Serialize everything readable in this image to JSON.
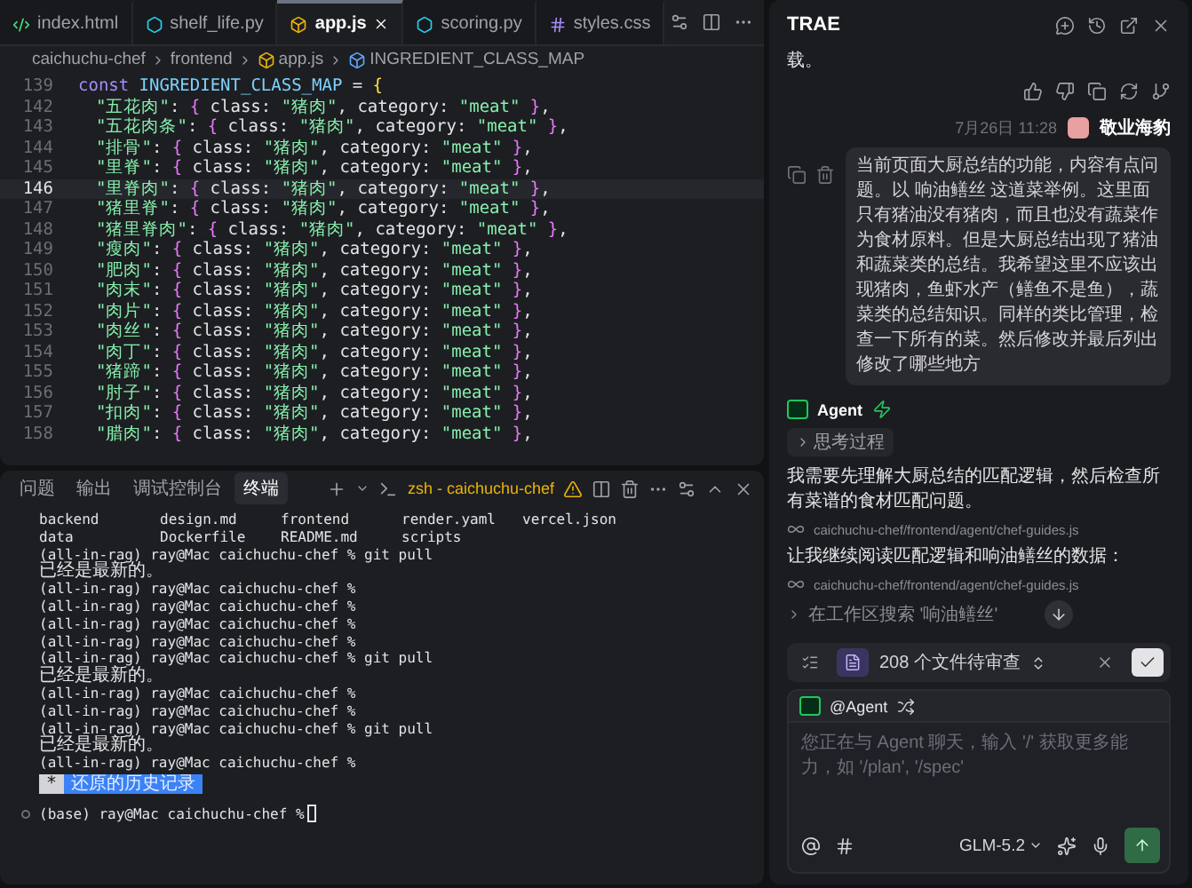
{
  "editor": {
    "tabs": [
      {
        "label": "index.html",
        "kind": "html",
        "selected": false
      },
      {
        "label": "shelf_life.py",
        "kind": "py",
        "selected": false
      },
      {
        "label": "app.js",
        "kind": "js",
        "selected": true
      },
      {
        "label": "scoring.py",
        "kind": "py",
        "selected": false
      },
      {
        "label": "styles.css",
        "kind": "css",
        "selected": false
      }
    ],
    "breadcrumb": [
      {
        "label": "caichuchu-chef",
        "kind": "folder"
      },
      {
        "label": "frontend",
        "kind": "folder"
      },
      {
        "label": "app.js",
        "kind": "js"
      },
      {
        "label": "INGREDIENT_CLASS_MAP",
        "kind": "symbol"
      }
    ],
    "lines": [
      {
        "number": "139",
        "indent": false,
        "current": false,
        "tokens": [
          {
            "kind": "keyword",
            "text": "const"
          },
          {
            "kind": "constant",
            "text": "INGREDIENT_CLASS_MAP"
          },
          {
            "kind": "plain",
            "text": "="
          },
          {
            "kind": "outer",
            "text": "{"
          }
        ]
      },
      {
        "number": "142",
        "indent": true,
        "current": false,
        "tokens": [
          {
            "kind": "string",
            "text": "\"五花肉\""
          },
          {
            "kind": "plain",
            "text": ":"
          },
          {
            "kind": "brace",
            "text": "{"
          },
          {
            "kind": "plain",
            "text": "class:"
          },
          {
            "kind": "string",
            "text": "\"猪肉\""
          },
          {
            "kind": "plain",
            "text": ", category:"
          },
          {
            "kind": "string",
            "text": "\"meat\""
          },
          {
            "kind": "brace",
            "text": "}"
          },
          {
            "kind": "plain",
            "text": ","
          }
        ]
      },
      {
        "number": "143",
        "indent": true,
        "current": false,
        "tokens": [
          {
            "kind": "string",
            "text": "\"五花肉条\""
          },
          {
            "kind": "plain",
            "text": ":"
          },
          {
            "kind": "brace",
            "text": "{"
          },
          {
            "kind": "plain",
            "text": "class:"
          },
          {
            "kind": "string",
            "text": "\"猪肉\""
          },
          {
            "kind": "plain",
            "text": ", category:"
          },
          {
            "kind": "string",
            "text": "\"meat\""
          },
          {
            "kind": "brace",
            "text": "}"
          },
          {
            "kind": "plain",
            "text": ","
          }
        ]
      },
      {
        "number": "144",
        "indent": true,
        "current": false,
        "tokens": [
          {
            "kind": "string",
            "text": "\"排骨\""
          },
          {
            "kind": "plain",
            "text": ":"
          },
          {
            "kind": "brace",
            "text": "{"
          },
          {
            "kind": "plain",
            "text": "class:"
          },
          {
            "kind": "string",
            "text": "\"猪肉\""
          },
          {
            "kind": "plain",
            "text": ", category:"
          },
          {
            "kind": "string",
            "text": "\"meat\""
          },
          {
            "kind": "brace",
            "text": "}"
          },
          {
            "kind": "plain",
            "text": ","
          }
        ]
      },
      {
        "number": "145",
        "indent": true,
        "current": false,
        "tokens": [
          {
            "kind": "string",
            "text": "\"里脊\""
          },
          {
            "kind": "plain",
            "text": ":"
          },
          {
            "kind": "brace",
            "text": "{"
          },
          {
            "kind": "plain",
            "text": "class:"
          },
          {
            "kind": "string",
            "text": "\"猪肉\""
          },
          {
            "kind": "plain",
            "text": ", category:"
          },
          {
            "kind": "string",
            "text": "\"meat\""
          },
          {
            "kind": "brace",
            "text": "}"
          },
          {
            "kind": "plain",
            "text": ","
          }
        ]
      },
      {
        "number": "146",
        "indent": true,
        "current": true,
        "tokens": [
          {
            "kind": "string",
            "text": "\"里脊肉\""
          },
          {
            "kind": "plain",
            "text": ":"
          },
          {
            "kind": "brace",
            "text": "{"
          },
          {
            "kind": "plain",
            "text": "class:"
          },
          {
            "kind": "string",
            "text": "\"猪肉\""
          },
          {
            "kind": "plain",
            "text": ", category:"
          },
          {
            "kind": "string",
            "text": "\"meat\""
          },
          {
            "kind": "brace",
            "text": "}"
          },
          {
            "kind": "plain",
            "text": ","
          }
        ]
      },
      {
        "number": "147",
        "indent": true,
        "current": false,
        "tokens": [
          {
            "kind": "string",
            "text": "\"猪里脊\""
          },
          {
            "kind": "plain",
            "text": ":"
          },
          {
            "kind": "brace",
            "text": "{"
          },
          {
            "kind": "plain",
            "text": "class:"
          },
          {
            "kind": "string",
            "text": "\"猪肉\""
          },
          {
            "kind": "plain",
            "text": ", category:"
          },
          {
            "kind": "string",
            "text": "\"meat\""
          },
          {
            "kind": "brace",
            "text": "}"
          },
          {
            "kind": "plain",
            "text": ","
          }
        ]
      },
      {
        "number": "148",
        "indent": true,
        "current": false,
        "tokens": [
          {
            "kind": "string",
            "text": "\"猪里脊肉\""
          },
          {
            "kind": "plain",
            "text": ":"
          },
          {
            "kind": "brace",
            "text": "{"
          },
          {
            "kind": "plain",
            "text": "class:"
          },
          {
            "kind": "string",
            "text": "\"猪肉\""
          },
          {
            "kind": "plain",
            "text": ", category:"
          },
          {
            "kind": "string",
            "text": "\"meat\""
          },
          {
            "kind": "brace",
            "text": "}"
          },
          {
            "kind": "plain",
            "text": ","
          }
        ]
      },
      {
        "number": "149",
        "indent": true,
        "current": false,
        "tokens": [
          {
            "kind": "string",
            "text": "\"瘦肉\""
          },
          {
            "kind": "plain",
            "text": ":"
          },
          {
            "kind": "brace",
            "text": "{"
          },
          {
            "kind": "plain",
            "text": "class:"
          },
          {
            "kind": "string",
            "text": "\"猪肉\""
          },
          {
            "kind": "plain",
            "text": ", category:"
          },
          {
            "kind": "string",
            "text": "\"meat\""
          },
          {
            "kind": "brace",
            "text": "}"
          },
          {
            "kind": "plain",
            "text": ","
          }
        ]
      },
      {
        "number": "150",
        "indent": true,
        "current": false,
        "tokens": [
          {
            "kind": "string",
            "text": "\"肥肉\""
          },
          {
            "kind": "plain",
            "text": ":"
          },
          {
            "kind": "brace",
            "text": "{"
          },
          {
            "kind": "plain",
            "text": "class:"
          },
          {
            "kind": "string",
            "text": "\"猪肉\""
          },
          {
            "kind": "plain",
            "text": ", category:"
          },
          {
            "kind": "string",
            "text": "\"meat\""
          },
          {
            "kind": "brace",
            "text": "}"
          },
          {
            "kind": "plain",
            "text": ","
          }
        ]
      },
      {
        "number": "151",
        "indent": true,
        "current": false,
        "tokens": [
          {
            "kind": "string",
            "text": "\"肉末\""
          },
          {
            "kind": "plain",
            "text": ":"
          },
          {
            "kind": "brace",
            "text": "{"
          },
          {
            "kind": "plain",
            "text": "class:"
          },
          {
            "kind": "string",
            "text": "\"猪肉\""
          },
          {
            "kind": "plain",
            "text": ", category:"
          },
          {
            "kind": "string",
            "text": "\"meat\""
          },
          {
            "kind": "brace",
            "text": "}"
          },
          {
            "kind": "plain",
            "text": ","
          }
        ]
      },
      {
        "number": "152",
        "indent": true,
        "current": false,
        "tokens": [
          {
            "kind": "string",
            "text": "\"肉片\""
          },
          {
            "kind": "plain",
            "text": ":"
          },
          {
            "kind": "brace",
            "text": "{"
          },
          {
            "kind": "plain",
            "text": "class:"
          },
          {
            "kind": "string",
            "text": "\"猪肉\""
          },
          {
            "kind": "plain",
            "text": ", category:"
          },
          {
            "kind": "string",
            "text": "\"meat\""
          },
          {
            "kind": "brace",
            "text": "}"
          },
          {
            "kind": "plain",
            "text": ","
          }
        ]
      },
      {
        "number": "153",
        "indent": true,
        "current": false,
        "tokens": [
          {
            "kind": "string",
            "text": "\"肉丝\""
          },
          {
            "kind": "plain",
            "text": ":"
          },
          {
            "kind": "brace",
            "text": "{"
          },
          {
            "kind": "plain",
            "text": "class:"
          },
          {
            "kind": "string",
            "text": "\"猪肉\""
          },
          {
            "kind": "plain",
            "text": ", category:"
          },
          {
            "kind": "string",
            "text": "\"meat\""
          },
          {
            "kind": "brace",
            "text": "}"
          },
          {
            "kind": "plain",
            "text": ","
          }
        ]
      },
      {
        "number": "154",
        "indent": true,
        "current": false,
        "tokens": [
          {
            "kind": "string",
            "text": "\"肉丁\""
          },
          {
            "kind": "plain",
            "text": ":"
          },
          {
            "kind": "brace",
            "text": "{"
          },
          {
            "kind": "plain",
            "text": "class:"
          },
          {
            "kind": "string",
            "text": "\"猪肉\""
          },
          {
            "kind": "plain",
            "text": ", category:"
          },
          {
            "kind": "string",
            "text": "\"meat\""
          },
          {
            "kind": "brace",
            "text": "}"
          },
          {
            "kind": "plain",
            "text": ","
          }
        ]
      },
      {
        "number": "155",
        "indent": true,
        "current": false,
        "tokens": [
          {
            "kind": "string",
            "text": "\"猪蹄\""
          },
          {
            "kind": "plain",
            "text": ":"
          },
          {
            "kind": "brace",
            "text": "{"
          },
          {
            "kind": "plain",
            "text": "class:"
          },
          {
            "kind": "string",
            "text": "\"猪肉\""
          },
          {
            "kind": "plain",
            "text": ", category:"
          },
          {
            "kind": "string",
            "text": "\"meat\""
          },
          {
            "kind": "brace",
            "text": "}"
          },
          {
            "kind": "plain",
            "text": ","
          }
        ]
      },
      {
        "number": "156",
        "indent": true,
        "current": false,
        "tokens": [
          {
            "kind": "string",
            "text": "\"肘子\""
          },
          {
            "kind": "plain",
            "text": ":"
          },
          {
            "kind": "brace",
            "text": "{"
          },
          {
            "kind": "plain",
            "text": "class:"
          },
          {
            "kind": "string",
            "text": "\"猪肉\""
          },
          {
            "kind": "plain",
            "text": ", category:"
          },
          {
            "kind": "string",
            "text": "\"meat\""
          },
          {
            "kind": "brace",
            "text": "}"
          },
          {
            "kind": "plain",
            "text": ","
          }
        ]
      },
      {
        "number": "157",
        "indent": true,
        "current": false,
        "tokens": [
          {
            "kind": "string",
            "text": "\"扣肉\""
          },
          {
            "kind": "plain",
            "text": ":"
          },
          {
            "kind": "brace",
            "text": "{"
          },
          {
            "kind": "plain",
            "text": "class:"
          },
          {
            "kind": "string",
            "text": "\"猪肉\""
          },
          {
            "kind": "plain",
            "text": ", category:"
          },
          {
            "kind": "string",
            "text": "\"meat\""
          },
          {
            "kind": "brace",
            "text": "}"
          },
          {
            "kind": "plain",
            "text": ","
          }
        ]
      },
      {
        "number": "158",
        "indent": true,
        "current": false,
        "tokens": [
          {
            "kind": "string",
            "text": "\"腊肉\""
          },
          {
            "kind": "plain",
            "text": ":"
          },
          {
            "kind": "brace",
            "text": "{"
          },
          {
            "kind": "plain",
            "text": "class:"
          },
          {
            "kind": "string",
            "text": "\"猪肉\""
          },
          {
            "kind": "plain",
            "text": ", category:"
          },
          {
            "kind": "string",
            "text": "\"meat\""
          },
          {
            "kind": "brace",
            "text": "}"
          },
          {
            "kind": "plain",
            "text": ","
          }
        ]
      }
    ]
  },
  "panel": {
    "tabs": [
      {
        "label": "问题",
        "selected": false
      },
      {
        "label": "输出",
        "selected": false
      },
      {
        "label": "调试控制台",
        "selected": false
      },
      {
        "label": "终端",
        "selected": true
      }
    ],
    "terminal_name": "zsh - caichuchu-chef",
    "listing": [
      [
        "backend",
        "design.md",
        "frontend",
        "render.yaml",
        "vercel.json"
      ],
      [
        "data",
        "Dockerfile",
        "README.md",
        "scripts"
      ]
    ],
    "lines": [
      "(all-in-rag) ray@Mac caichuchu-chef % git pull",
      "已经是最新的。",
      "(all-in-rag) ray@Mac caichuchu-chef %",
      "(all-in-rag) ray@Mac caichuchu-chef %",
      "(all-in-rag) ray@Mac caichuchu-chef %",
      "(all-in-rag) ray@Mac caichuchu-chef %",
      "(all-in-rag) ray@Mac caichuchu-chef % git pull",
      "已经是最新的。",
      "(all-in-rag) ray@Mac caichuchu-chef %",
      "(all-in-rag) ray@Mac caichuchu-chef %",
      "(all-in-rag) ray@Mac caichuchu-chef % git pull",
      "已经是最新的。",
      "(all-in-rag) ray@Mac caichuchu-chef %"
    ],
    "history": {
      "key": "*",
      "label": "还原的历史记录"
    },
    "prompt": "(base) ray@Mac caichuchu-chef %"
  },
  "chat": {
    "title": "TRAE",
    "previous_tail": "载。",
    "user": {
      "time": "7月26日 11:28",
      "name": "敬业海豹",
      "message": "当前页面大厨总结的功能，内容有点问题。以 响油鳝丝 这道菜举例。这里面只有猪油没有猪肉，而且也没有蔬菜作为食材原料。但是大厨总结出现了猪油和蔬菜类的总结。我希望这里不应该出现猪肉，鱼虾水产（鳝鱼不是鱼），蔬菜类的总结知识。同样的类比管理，检查一下所有的菜。然后修改并最后列出修改了哪些地方"
    },
    "agent": {
      "name": "Agent",
      "thinking": "思考过程",
      "items": [
        {
          "kind": "text",
          "text": "我需要先理解大厨总结的匹配逻辑，然后检查所有菜谱的食材匹配问题。"
        },
        {
          "kind": "file",
          "text": "caichuchu-chef/frontend/agent/chef-guides.js"
        },
        {
          "kind": "text",
          "text": "让我继续阅读匹配逻辑和响油鳝丝的数据："
        },
        {
          "kind": "file",
          "text": "caichuchu-chef/frontend/agent/chef-guides.js"
        },
        {
          "kind": "search",
          "text": "在工作区搜索 '响油鳝丝'"
        }
      ]
    },
    "review": {
      "label": "208 个文件待审查"
    },
    "input": {
      "mention": "@Agent",
      "placeholder": "您正在与 Agent 聊天，输入 '/' 获取更多能力，如 '/plan', '/spec'",
      "model": "GLM-5.2"
    }
  }
}
